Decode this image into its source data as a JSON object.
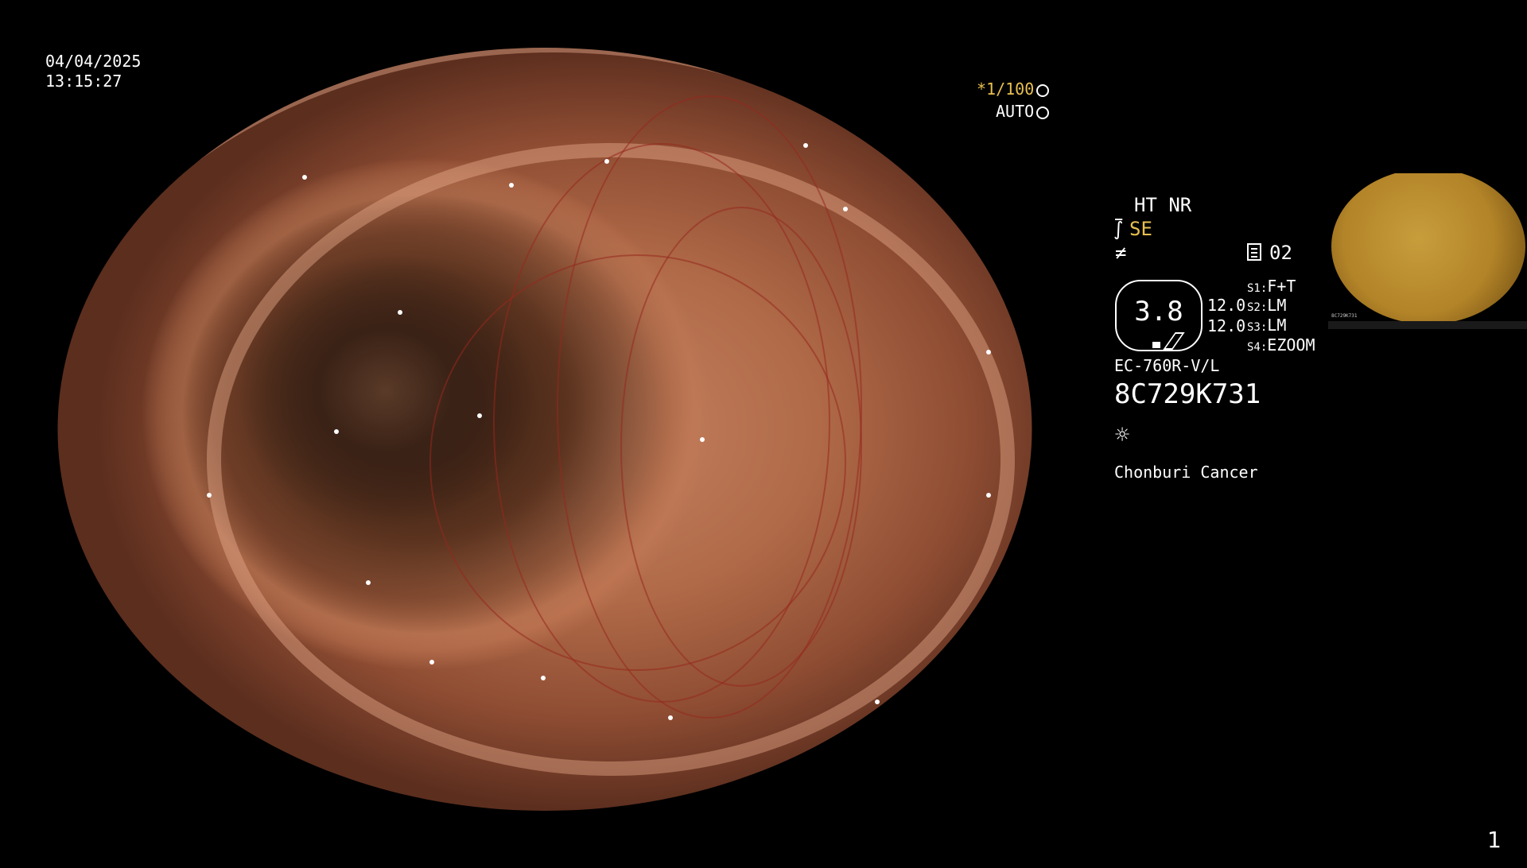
{
  "overlay": {
    "date": "04/04/2025",
    "time": "13:15:27",
    "shutter": "*1/100",
    "auto": "AUTO"
  },
  "settings": {
    "ht_nr": "HT NR",
    "se": "SE",
    "f_symbol": "≠",
    "doc_number": "02",
    "octagon_value": "3.8",
    "value_top": "12.0",
    "value_bottom": "12.0",
    "s1_label": "S1:",
    "s1_value": "F+T",
    "s2_label": "S2:",
    "s2_value": "LM",
    "s3_label": "S3:",
    "s3_value": "LM",
    "s4_label": "S4:",
    "s4_value": "EZOOM",
    "model": "EC-760R-V/L",
    "serial": "8C729K731",
    "hospital": "Chonburi Cancer"
  },
  "page_number": "1",
  "pip": {
    "serial_caption": "8C729K731"
  },
  "colors": {
    "accent_yellow": "#e8c050",
    "background": "#000000"
  }
}
